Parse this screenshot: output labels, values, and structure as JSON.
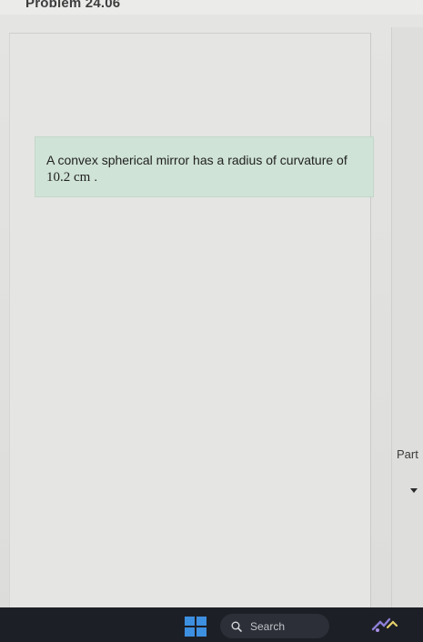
{
  "header": {
    "title": "Problem 24.06"
  },
  "problem": {
    "text_before_value": "A convex spherical mirror has a radius of curvature of ",
    "value": "10.2 cm",
    "text_after_value": " ."
  },
  "side_panel": {
    "part_label": "Part"
  },
  "taskbar": {
    "search_label": "Search",
    "accent_color": "#3d8fe0"
  }
}
